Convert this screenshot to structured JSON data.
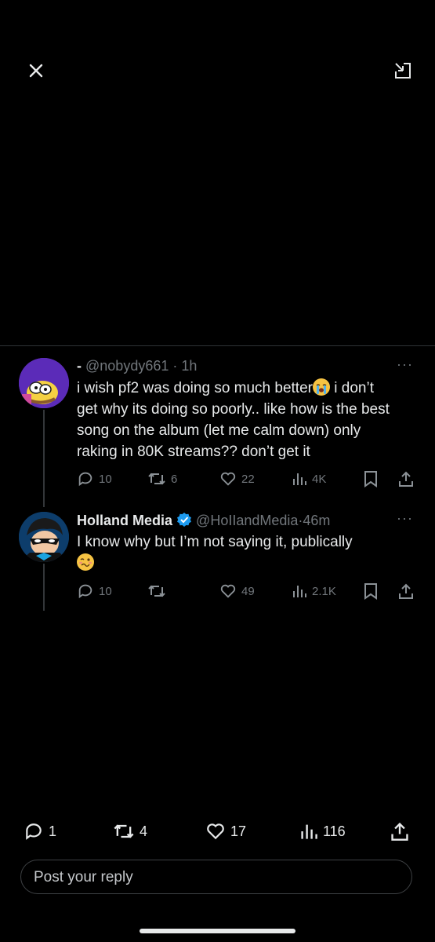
{
  "top_bar": {
    "close_icon": "close-icon",
    "expand_icon": "pip-expand-icon"
  },
  "tweets": [
    {
      "display_name": "-",
      "handle": "@nobydy661",
      "sep": "·",
      "time": "1h",
      "text_before_emoji": "i wish pf2 was doing so much better",
      "emoji": "😭",
      "text_after_emoji": " i don’t get why its doing so poorly.. like how is the best song on the album (let me calm down) only raking in 80K streams?? don’t get it",
      "more": "···",
      "replies": "10",
      "retweets": "6",
      "likes": "22",
      "views": "4K"
    },
    {
      "display_name": "Holland Media",
      "verified_icon": "verified-badge-icon",
      "handle": "@HoIIandMedia",
      "sep": "·",
      "time": "46m",
      "text": "I know why but I’m not saying it, publically",
      "emoji": "🥴",
      "more": "···",
      "replies": "10",
      "retweets": "",
      "likes": "49",
      "views": "2.1K"
    }
  ],
  "bottom_actions": {
    "replies": "1",
    "retweets": "4",
    "likes": "17",
    "views": "116"
  },
  "reply_input": {
    "placeholder": "Post your reply"
  },
  "colors": {
    "background": "#000000",
    "text": "#e7e9ea",
    "muted": "#71767b",
    "verified": "#1d9bf0"
  }
}
